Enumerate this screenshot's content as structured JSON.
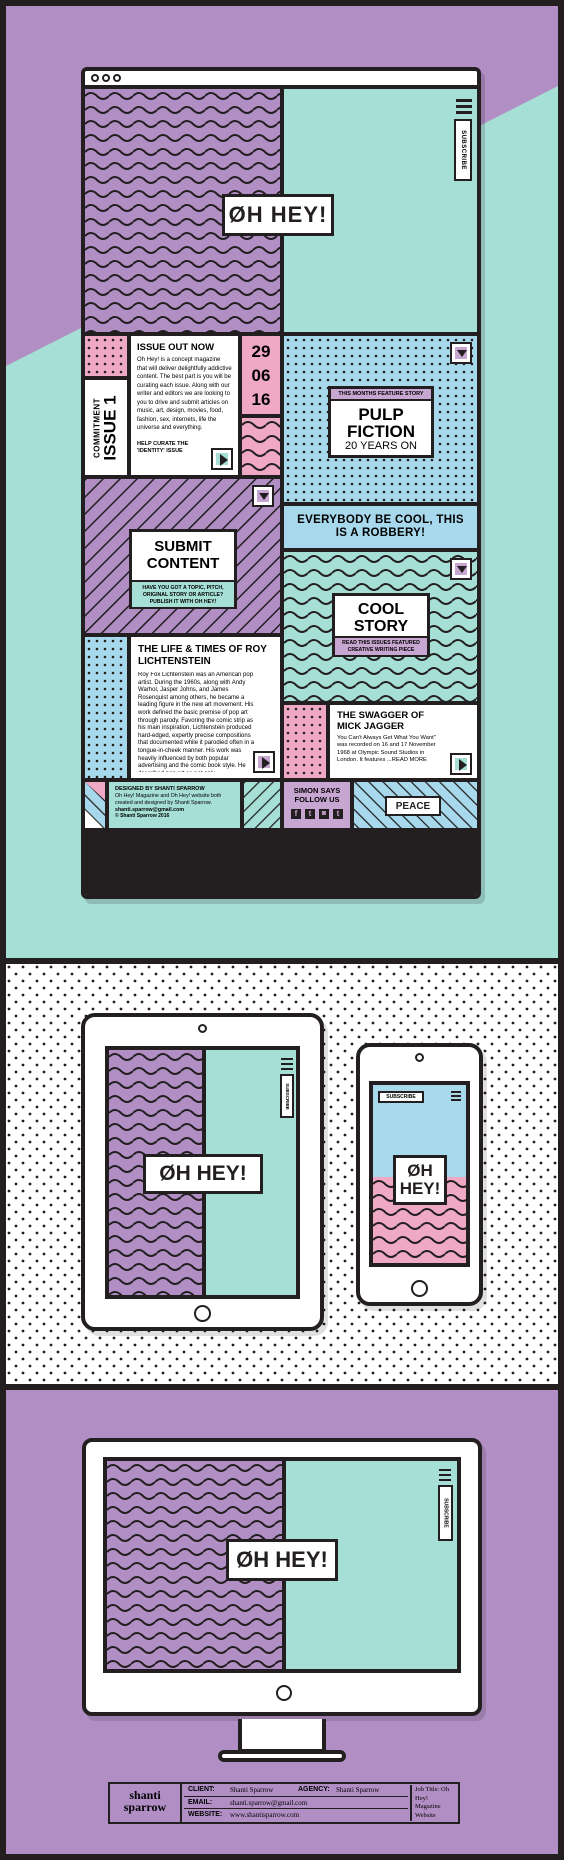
{
  "colors": {
    "purple": "#b18fc4",
    "lilac": "#c8a6d2",
    "mint": "#a6dfd6",
    "pink": "#f0a9c4",
    "blue": "#a7d8ec",
    "ink": "#231f20",
    "white": "#ffffff"
  },
  "browser": {
    "logo": "ØH HEY!",
    "subscribe": "SUBSCRIBE"
  },
  "issue": {
    "vertical_small": "COMMITMENT",
    "vertical_big": "ISSUE 1",
    "title": "ISSUE OUT NOW",
    "body": "Oh Hey! is a concept magazine that will deliver delightfully addictive content. The best part is you will be curating each issue. Along with our writer and editors we are looking to you to drive and submit articles on music, art, design, movies, food, fashion, sex, internets, life the universe and everything.",
    "cta": "HELP CURATE THE 'IDENTITY' ISSUE"
  },
  "date": {
    "day": "29",
    "month": "06",
    "year": "16"
  },
  "feature": {
    "kicker": "THIS MONTHS FEATURE STORY",
    "title": "PULP FICTION",
    "sub": "20 YEARS ON"
  },
  "quote": "EVERYBODY BE COOL, THIS IS A ROBBERY!",
  "submit": {
    "title": "SUBMIT CONTENT",
    "body": "HAVE YOU GOT A TOPIC, PITCH, ORIGINAL STORY OR ARTICLE? PUBLISH IT WITH OH HEY!"
  },
  "cool": {
    "title": "COOL STORY",
    "body": "READ THIS ISSUES FEATURED CREATIVE WRITING PIECE"
  },
  "roy": {
    "title": "THE LIFE & TIMES OF ROY LICHTENSTEIN",
    "body": "Roy Fox Lichtenstein was an American pop artist. During the 1960s, along with Andy Warhol, Jasper Johns, and James Rosenquist among others, he became a leading figure in the new art movement. His work defined the basic premise of pop art through parody. Favoring the comic strip as his main inspiration, Lichtenstein produced hard-edged, expertly precise compositions that documented while it parodied often in a tongue-in-cheek manner. His work was heavily influenced by both popular advertising and the comic book style. He described pop art as not only seductively...READ MORE"
  },
  "jagger": {
    "title": "THE SWAGGER OF MICK JAGGER",
    "body": "You Can't Always Get What You Want\" was recorded on 16 and 17 November 1968 at Olympic Sound Studios in London. It features ...READ MORE"
  },
  "footer": {
    "designed_by": "DESIGNED BY SHANTI SPARROW",
    "credit": "Oh Hey! Magazine and Oh Hey! website both created and designed by Shanti Sparrow.",
    "email": "shanti.sparrow@gmail.com",
    "copyright": "© Shanti Sparrow 2016",
    "simon": "SIMON SAYS FOLLOW US",
    "peace": "PEACE",
    "social": [
      "f",
      "t",
      "◙",
      "t"
    ]
  },
  "tablet": {
    "logo": "ØH HEY!",
    "subscribe": "SUBSCRIBE"
  },
  "phone": {
    "logo": "ØH HEY!",
    "subscribe": "SUBSCRIBE"
  },
  "desktop": {
    "logo": "ØH HEY!",
    "subscribe": "SUBSCRIBE"
  },
  "credits": {
    "brand_top": "shanti",
    "brand_bottom": "sparrow",
    "client_label": "CLIENT:",
    "client": "Shanti Sparrow",
    "agency_label": "AGENCY:",
    "agency": "Shanti Sparrow",
    "email_label": "EMAIL:",
    "email": "shanti.sparrow@gmail.com",
    "website_label": "WEBSITE:",
    "website": "www.shantisparrow.com",
    "job_title": "Job Title: Oh Hey! Magazine Website"
  }
}
